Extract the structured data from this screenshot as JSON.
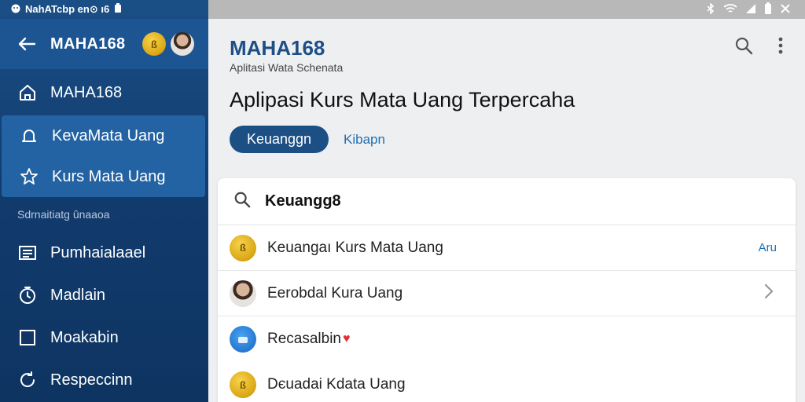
{
  "status": {
    "text": "NahATcbp en⊙ ı6"
  },
  "sidebar": {
    "title": "MAHA168",
    "items": [
      {
        "label": "MAHA168",
        "icon": "home-icon"
      },
      {
        "label": "KevaMata Uang",
        "icon": "bell-icon"
      },
      {
        "label": "Kurs Mata Uang",
        "icon": "star-icon"
      }
    ],
    "section_label": "Sdrnaitiatg ûnaaoa",
    "lower_items": [
      {
        "label": "Pumhaialaael",
        "icon": "list-icon"
      },
      {
        "label": "Madlain",
        "icon": "timer-icon"
      },
      {
        "label": "Moakabin",
        "icon": "square-icon"
      },
      {
        "label": "Respeccinn",
        "icon": "refresh-icon"
      }
    ],
    "coin_text": "ß"
  },
  "main": {
    "app_title": "MAHA168",
    "app_subtitle": "Aplitasi Wata Schenata",
    "headline": "Aplipasi Kurs Mata Uang Terpercaha",
    "chip_label": "Keuanggn",
    "link_label": "Kibapn",
    "search_value": "Keuangg8",
    "rows": [
      {
        "label": "Keuangaı Kurs Mata Uang",
        "right": "Aru",
        "icon": "coin-icon"
      },
      {
        "label": "Eerobdal Kura Uang",
        "icon": "avatar-icon"
      },
      {
        "label": "Recasalbin",
        "icon": "blue-badge-icon"
      },
      {
        "label": "Dєuadai Kdata Uang",
        "icon": "coin-icon"
      }
    ],
    "coin_text": "ß"
  },
  "colors": {
    "sidebar": "#123c6e",
    "accent": "#1c4f84",
    "link": "#1e6fb3"
  }
}
